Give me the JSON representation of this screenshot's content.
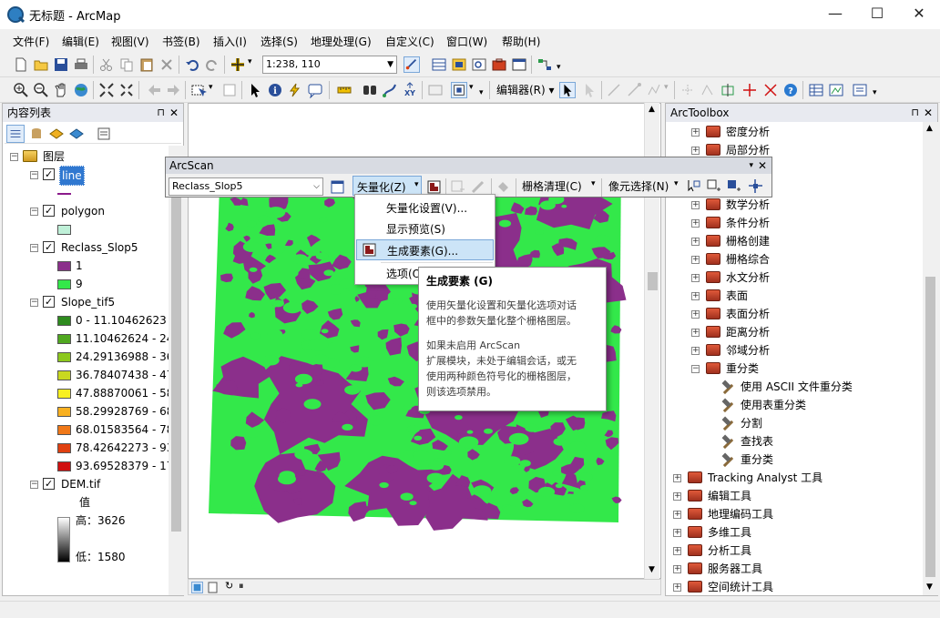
{
  "window": {
    "title": "无标题 - ArcMap",
    "controls": [
      "—",
      "☐",
      "✕"
    ]
  },
  "menu": [
    "文件(F)",
    "编辑(E)",
    "视图(V)",
    "书签(B)",
    "插入(I)",
    "选择(S)",
    "地理处理(G)",
    "自定义(C)",
    "窗口(W)",
    "帮助(H)"
  ],
  "toolbar": {
    "scale_value": "1:238, 110",
    "editor_label": "编辑器(R) ▾"
  },
  "toc": {
    "title": "内容列表",
    "root_label": "图层",
    "layers": [
      {
        "name": "line",
        "selected": true,
        "legend": [
          {
            "label": "",
            "color": "#8b1a8b",
            "kind": "line"
          }
        ]
      },
      {
        "name": "polygon",
        "legend": [
          {
            "label": "",
            "color": "#bff0d8",
            "kind": "fill"
          }
        ]
      },
      {
        "name": "Reclass_Slop5",
        "legend": [
          {
            "label": "1",
            "color": "#8b2f8b"
          },
          {
            "label": "9",
            "color": "#33e84a"
          }
        ]
      },
      {
        "name": "Slope_tif5",
        "legend": [
          {
            "label": "0 - 11.10462623",
            "color": "#2e8b1e"
          },
          {
            "label": "11.10462624 - 24.",
            "color": "#50a820"
          },
          {
            "label": "24.29136988 - 36.",
            "color": "#8cc81e"
          },
          {
            "label": "36.78407438 - 47.",
            "color": "#c8d820"
          },
          {
            "label": "47.88870061 - 58.",
            "color": "#f8f020"
          },
          {
            "label": "58.29928769 - 68.",
            "color": "#f8b020"
          },
          {
            "label": "68.01583564 - 78.",
            "color": "#f07818"
          },
          {
            "label": "78.42642273 - 93.",
            "color": "#e04010"
          },
          {
            "label": "93.69528379 - 17(",
            "color": "#d01010"
          }
        ]
      },
      {
        "name": "DEM.tif",
        "legend": [
          {
            "label": "值",
            "kind": "heading"
          },
          {
            "label": "高：3626",
            "kind": "ramp-top"
          },
          {
            "label": "低：1580",
            "kind": "ramp-bottom"
          }
        ]
      }
    ]
  },
  "arcscan": {
    "title": "ArcScan",
    "layer_combo": "Reclass_Slop5",
    "vectorize_menu": "矢量化(Z)",
    "raster_cleanup": "栅格清理(C)",
    "cell_select": "像元选择(N)",
    "dropdown_items": [
      "矢量化设置(V)...",
      "显示预览(S)",
      "生成要素(G)...",
      "选项(O)"
    ],
    "tooltip": {
      "title": "生成要素 (G)",
      "lines": [
        "使用矢量化设置和矢量化选项对话",
        "框中的参数矢量化整个栅格图层。",
        "",
        "如果未启用 ArcScan",
        "扩展模块，未处于编辑会话，或无",
        "使用两种颜色符号化的栅格图层，",
        "则该选项禁用。"
      ]
    }
  },
  "arctoolbox": {
    "title": "ArcToolbox",
    "items": [
      {
        "label": "密度分析",
        "level": 1,
        "kind": "toolset",
        "exp": "+"
      },
      {
        "label": "局部分析",
        "level": 1,
        "kind": "toolset",
        "exp": "+"
      },
      {
        "label": "数学分析",
        "level": 1,
        "kind": "toolset",
        "exp": "+"
      },
      {
        "label": "条件分析",
        "level": 1,
        "kind": "toolset",
        "exp": "+"
      },
      {
        "label": "栅格创建",
        "level": 1,
        "kind": "toolset",
        "exp": "+"
      },
      {
        "label": "栅格综合",
        "level": 1,
        "kind": "toolset",
        "exp": "+"
      },
      {
        "label": "水文分析",
        "level": 1,
        "kind": "toolset",
        "exp": "+"
      },
      {
        "label": "表面",
        "level": 1,
        "kind": "toolset",
        "exp": "+"
      },
      {
        "label": "表面分析",
        "level": 1,
        "kind": "toolset",
        "exp": "+"
      },
      {
        "label": "距离分析",
        "level": 1,
        "kind": "toolset",
        "exp": "+"
      },
      {
        "label": "邻域分析",
        "level": 1,
        "kind": "toolset",
        "exp": "+"
      },
      {
        "label": "重分类",
        "level": 1,
        "kind": "toolset",
        "exp": "−"
      },
      {
        "label": "使用 ASCII 文件重分类",
        "level": 2,
        "kind": "tool"
      },
      {
        "label": "使用表重分类",
        "level": 2,
        "kind": "tool"
      },
      {
        "label": "分割",
        "level": 2,
        "kind": "tool"
      },
      {
        "label": "查找表",
        "level": 2,
        "kind": "tool"
      },
      {
        "label": "重分类",
        "level": 2,
        "kind": "tool"
      },
      {
        "label": "Tracking Analyst 工具",
        "level": 0,
        "kind": "toolbox",
        "exp": "+"
      },
      {
        "label": "编辑工具",
        "level": 0,
        "kind": "toolbox",
        "exp": "+"
      },
      {
        "label": "地理编码工具",
        "level": 0,
        "kind": "toolbox",
        "exp": "+"
      },
      {
        "label": "多维工具",
        "level": 0,
        "kind": "toolbox",
        "exp": "+"
      },
      {
        "label": "分析工具",
        "level": 0,
        "kind": "toolbox",
        "exp": "+"
      },
      {
        "label": "服务器工具",
        "level": 0,
        "kind": "toolbox",
        "exp": "+"
      },
      {
        "label": "空间统计工具",
        "level": 0,
        "kind": "toolbox",
        "exp": "+"
      }
    ]
  },
  "colors": {
    "raster_purple": "#8b2f8b",
    "raster_green": "#33e84a",
    "highlight": "#cce4f7",
    "selected_layer": "#3078d0"
  }
}
